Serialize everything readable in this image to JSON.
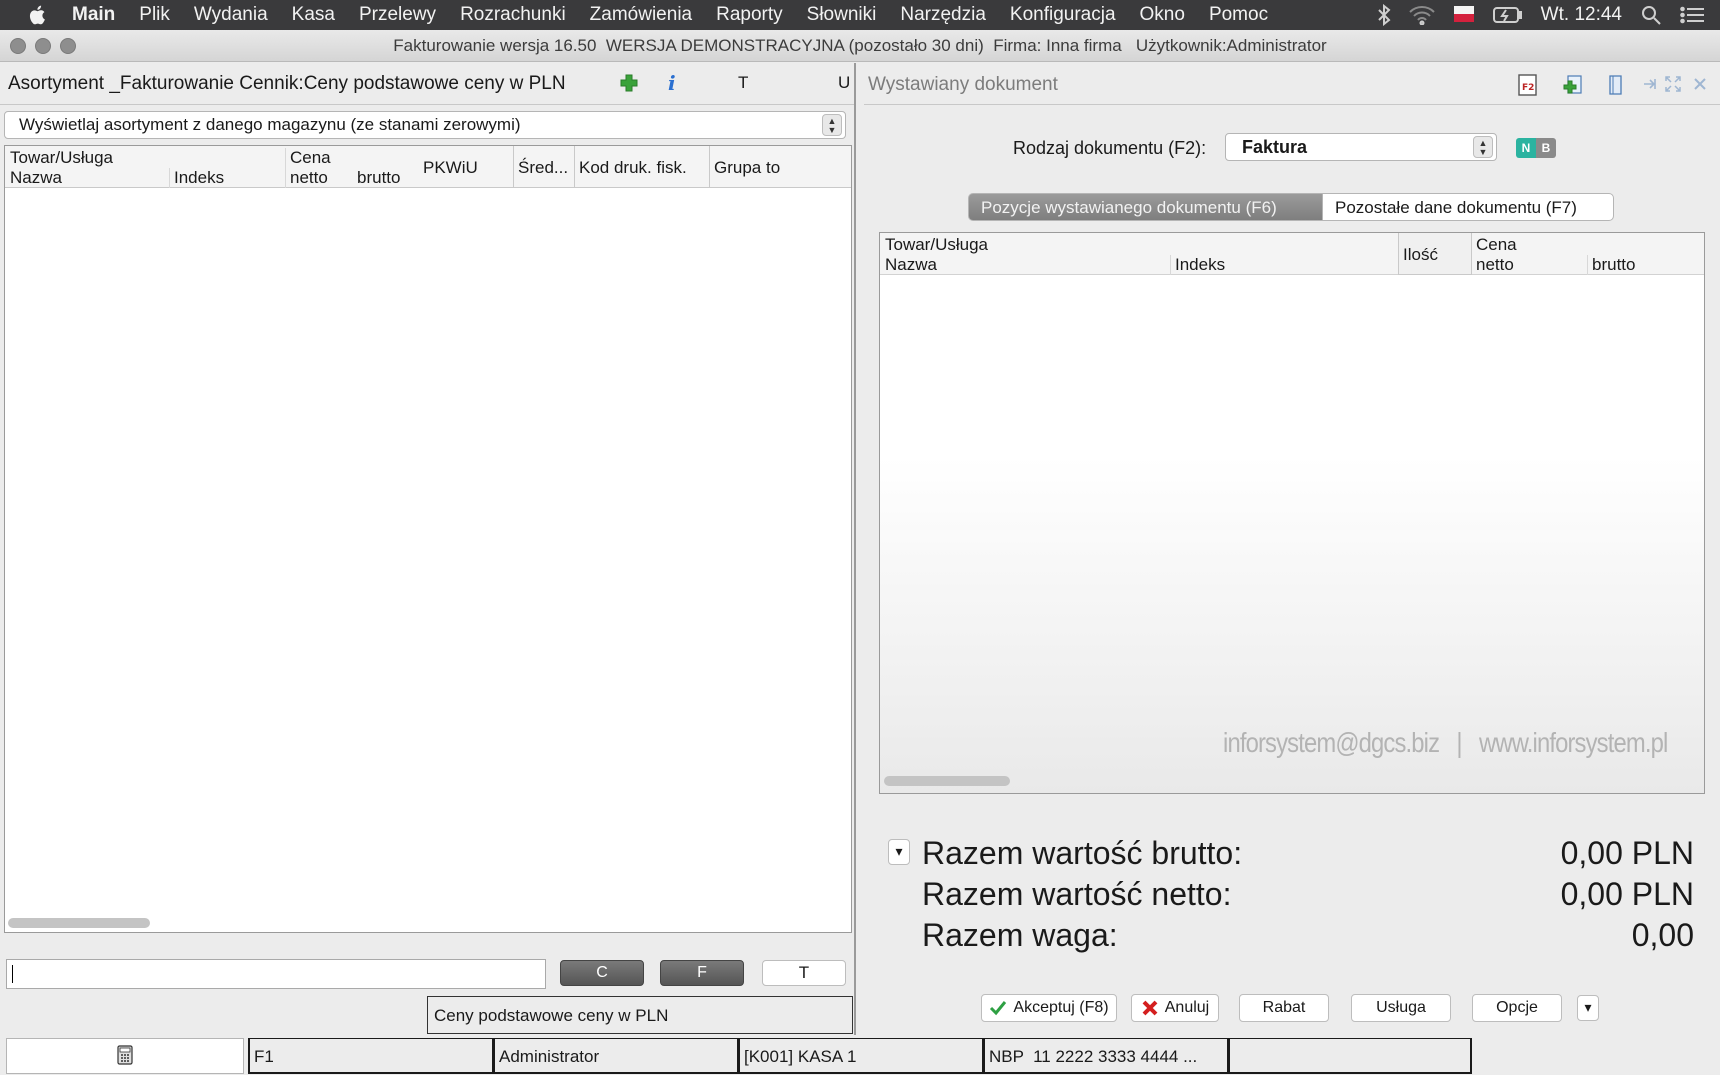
{
  "menubar": {
    "items": [
      "Main",
      "Plik",
      "Wydania",
      "Kasa",
      "Przelewy",
      "Rozrachunki",
      "Zamówienia",
      "Raporty",
      "Słowniki",
      "Narzędzia",
      "Konfiguracja",
      "Okno",
      "Pomoc"
    ],
    "clock": "Wt. 12:44"
  },
  "window": {
    "title": "Fakturowanie wersja 16.50  WERSJA DEMONSTRACYJNA (pozostało 30 dni)  Firma: Inna firma   Użytkownik:Administrator"
  },
  "left": {
    "header_title": "Asortyment _Fakturowanie Cennik:Ceny podstawowe ceny w PLN",
    "header_t": "T",
    "header_u": "U",
    "warehouse_select": "Wyświetlaj asortyment z danego magazynu (ze stanami zerowymi)",
    "table_headers": {
      "group": "Towar/Usługa",
      "name": "Nazwa",
      "index": "Indeks",
      "price_group": "Cena",
      "net": "netto",
      "gross": "brutto",
      "pkwiu": "PKWiU",
      "avg": "Śred...",
      "fiscal_code": "Kod druk. fisk.",
      "group_col": "Grupa to"
    },
    "btn_c": "C",
    "btn_f": "F",
    "btn_t": "T",
    "price_label": "Ceny podstawowe ceny w PLN"
  },
  "right": {
    "header_title": "Wystawiany dokument",
    "doc_type_label": "Rodzaj dokumentu (F2):",
    "doc_type_value": "Faktura",
    "badge_n": "N",
    "badge_b": "B",
    "tabs": [
      "Pozycje wystawianego dokumentu (F6)",
      "Pozostałe dane dokumentu (F7)"
    ],
    "table_headers": {
      "group": "Towar/Usługa",
      "name": "Nazwa",
      "index": "Indeks",
      "qty": "Ilość",
      "price_group": "Cena",
      "net": "netto",
      "gross": "brutto"
    },
    "watermark": "inforsystem@dgcs.biz   |   www.inforsystem.pl",
    "totals": [
      {
        "label": "Razem wartość brutto:",
        "value": "0,00 PLN"
      },
      {
        "label": "Razem wartość netto:",
        "value": "0,00 PLN"
      },
      {
        "label": "Razem waga:",
        "value": "0,00"
      }
    ],
    "buttons": {
      "accept": "Akceptuj (F8)",
      "cancel": "Anuluj",
      "discount": "Rabat",
      "service": "Usługa",
      "options": "Opcje"
    }
  },
  "statusbar": {
    "f1": "F1",
    "user": "Administrator",
    "cash": "[K001] KASA 1",
    "bank": "NBP  11 2222 3333 4444 ..."
  },
  "colors": {
    "menubar_bg": "#3a3a3c",
    "accent_green": "#3aa23a",
    "info_blue": "#2a6fd0",
    "badge_n": "#2bb3a0",
    "badge_b": "#8a8a8a",
    "cancel_red": "#d41f1f"
  }
}
